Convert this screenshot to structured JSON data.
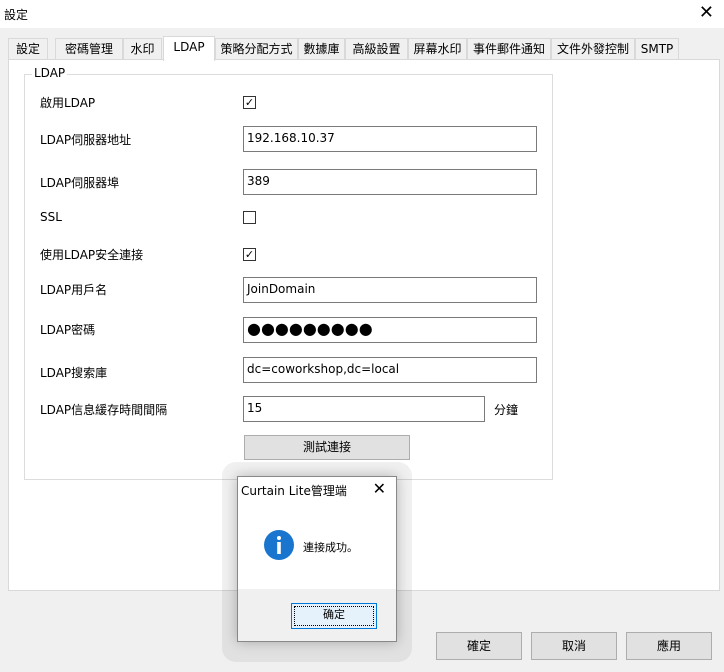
{
  "window": {
    "title": "設定",
    "close_glyph": "✕"
  },
  "tabs": [
    {
      "label": "設定"
    },
    {
      "label": "密碼管理"
    },
    {
      "label": "水印"
    },
    {
      "label": "LDAP",
      "active": true
    },
    {
      "label": "策略分配方式"
    },
    {
      "label": "數據庫"
    },
    {
      "label": "高級設置"
    },
    {
      "label": "屏幕水印"
    },
    {
      "label": "事件郵件通知"
    },
    {
      "label": "文件外發控制"
    },
    {
      "label": "SMTP"
    }
  ],
  "ldap": {
    "group_label": "LDAP",
    "enable_label": "啟用LDAP",
    "enable_checked": true,
    "server_address_label": "LDAP伺服器地址",
    "server_address_value": "192.168.10.37",
    "server_port_label": "LDAP伺服器埠",
    "server_port_value": "389",
    "ssl_label": "SSL",
    "ssl_checked": false,
    "secure_conn_label": "使用LDAP安全連接",
    "secure_conn_checked": true,
    "username_label": "LDAP用戶名",
    "username_value": "JoinDomain",
    "password_label": "LDAP密碼",
    "password_value": "●●●●●●●●●",
    "search_base_label": "LDAP搜索庫",
    "search_base_value": "dc=coworkshop,dc=local",
    "cache_interval_label": "LDAP信息緩存時間間隔",
    "cache_interval_value": "15",
    "cache_interval_unit": "分鐘",
    "test_button": "測試連接"
  },
  "footer": {
    "ok": "確定",
    "cancel": "取消",
    "apply": "應用"
  },
  "dialog": {
    "title": "Curtain Lite管理端",
    "close_glyph": "✕",
    "message": "連接成功。",
    "ok": "确定",
    "icon": "info-icon",
    "icon_color": "#1a75cf"
  },
  "colors": {
    "accent": "#0078d7",
    "info_icon": "#1a75cf"
  }
}
